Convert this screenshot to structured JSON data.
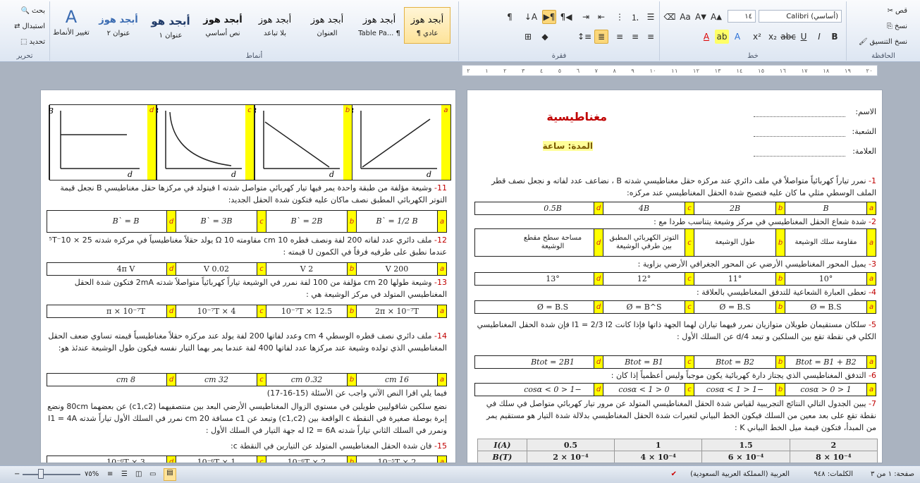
{
  "ribbon": {
    "clipboard": {
      "label": "الحافظة",
      "cut": "قص",
      "copy": "نسخ",
      "format_painter": "نسخ التنسيق"
    },
    "font": {
      "label": "خط",
      "font_name": "(أساسي) Calibri",
      "font_size": "١٤"
    },
    "paragraph": {
      "label": "فقرة"
    },
    "styles": {
      "label": "أنماط",
      "items": [
        {
          "preview": "أبجد هوز",
          "name": "¶ عادي"
        },
        {
          "preview": "أبجد هوز",
          "name": "Table Pa... ¶"
        },
        {
          "preview": "أبجد هوز",
          "name": "العنوان"
        },
        {
          "preview": "أبجد هوز",
          "name": "بلا تباعد"
        },
        {
          "preview": "أبجد هوز",
          "name": "نص أساسي"
        },
        {
          "preview": "أبجد هو",
          "name": "عنوان ١"
        },
        {
          "preview": "أبجد هوز",
          "name": "عنوان ٢"
        }
      ],
      "change_styles": "تغيير الأنماط"
    },
    "editing": {
      "label": "تحرير",
      "find": "بحث",
      "replace": "استبدال",
      "select": "تحديد"
    }
  },
  "ruler": {
    "ticks": [
      "٢",
      "١",
      "٢",
      "٣",
      "٤",
      "٥",
      "٦",
      "٧",
      "٨",
      "٩",
      "١٠",
      "١١",
      "١٢",
      "١٣",
      "١٤",
      "١٥",
      "١٦",
      "١٧",
      "١٨",
      "١٩",
      "٢٠"
    ]
  },
  "right_page": {
    "title": "مغناطيسية",
    "duration": "المدة: ساعة",
    "name_label": "الاسم:",
    "section_label": "الشعبة:",
    "grade_label": "العلامة:",
    "q1": {
      "num": "1-",
      "text": "نمرر تياراً كهربائياً متواصلاً في ملف دائري عند مركزه حقل مغناطيسي شدته B ، نضاعف عدد لفاته و نجعل نصف قطر الملف الوسطي مثلي ما كان عليه فتصبح شدة الحقل المغناطيسي عند مركزه:",
      "opts": [
        "B",
        "2B",
        "4B",
        "0.5B"
      ]
    },
    "q2": {
      "num": "2-",
      "text": "شدة شعاع الحقل المغناطيسي في مركز وشيعة يتناسب طردا مع :",
      "opts": [
        "مقاومة سلك الوشيعة",
        "طول الوشيعة",
        "التوتر الكهربائي المطبق بين طرفي الوشيعة",
        "مساحة سطح مقطع الوشيعة"
      ]
    },
    "q3": {
      "num": "3-",
      "text": "يميل المحور المغناطيسي الأرضي عن المحور الجغرافي الأرضي بزاوية :",
      "opts": [
        "10°",
        "11°",
        "12°",
        "13°"
      ]
    },
    "q4": {
      "num": "4-",
      "text": "تعطى العبارة الشعاعية للتدفق المغناطيسي بالعلاقة :",
      "opts": [
        "Ø = B.S",
        "Ø = B.S",
        "Ø = B^S",
        "Ø = B.S"
      ]
    },
    "q5": {
      "num": "5-",
      "text": "سلكان مستقيمان طويلان متوازيان نمرر فيهما تياران لهما الجهة ذاتها فإذا كانت I1 = 2/3 I2 فإن شدة الحقل المغناطيسي الكلي في نقطة تقع بين السلكين و تبعد d/4 عن السلك الأول :",
      "opts": [
        "Btot = B1 + B2",
        "Btot = B2",
        "Btot = B1",
        "Btot = 2B1"
      ]
    },
    "q6": {
      "num": "6-",
      "text": "التدفق المغناطيسي الذي يجتاز دارة كهربائية يكون موجباً وليس أعظمياً إذا كان :",
      "opts": [
        "1 < cosα > 0",
        "−1 < cosα < 1",
        "0 < cosα < 1",
        "−1 < cosα < 0"
      ]
    },
    "q7": {
      "num": "7-",
      "text": "يبين الجدول التالي النتائج التجريبية لقياس شدة الحقل المغناطيسي المتولد عن مرور تيار كهربائي متواصل في سلك في نقطة تقع على بعد معين من السلك فيكون الخط البياني لتغيرات شدة الحقل المغناطيسي بدلالة شدة التيار هو مستقيم يمر من المبدأ، فتكون قيمة ميل الخط البياني K :"
    },
    "table": {
      "headers": [
        "I(A)",
        "0.5",
        "1",
        "1.5",
        "2"
      ],
      "row2": [
        "B(T)",
        "2 × 10⁻⁴",
        "4 × 10⁻⁴",
        "6 × 10⁻⁴",
        "8 × 10⁻⁴"
      ]
    }
  },
  "left_page": {
    "letters": [
      "a",
      "b",
      "c",
      "d"
    ],
    "graph_axis": {
      "y": "B",
      "x": "d"
    },
    "q11": {
      "num": "11-",
      "text": "وشيعة مؤلفة من طبقة واحدة يمر فيها تيار كهربائي متواصل شدته I فيتولد في مركزها حقل مغناطيسي B نجعل قيمة التوتر الكهربائي المطبق نصف ماكان عليه فتكون شدة الحقل الجديد:",
      "opts": [
        "B` = 1/2 B",
        "B` = 2B",
        "B` = 3B",
        "B` = B"
      ]
    },
    "q12": {
      "num": "12-",
      "text": "ملف دائري عدد لفاته 200 لفة ونصف قطره 10 cm مقاومته 10 Ω يولد حقلاً مغناطيسياً في مركزه شدته 25 × 10⁻⁵T عندما نطبق على طرفيه فرقاً في الكمون U قيمته :",
      "opts": [
        "200 V",
        "2 V",
        "0.02 V",
        "4π V"
      ]
    },
    "q13": {
      "num": "13-",
      "text": "وشيعة طولها 20 cm مؤلفة من 100 لفة نمرر في الوشيعة تياراً كهربائياً متواصلاً شدته 2mA فتكون شدة الحقل المغناطيسي المتولد في مركز الوشيعة هي :",
      "opts": [
        "2π × 10⁻⁷T",
        "12.5 × 10⁻⁷T",
        "4 × 10⁻⁷T",
        "π × 10⁻⁷T"
      ]
    },
    "q14": {
      "num": "14-",
      "text": "ملف دائري نصف قطره الوسطي 4 cm وعدد لفاتها 200 لفة يولد عند مركزه حقلاً مغناطيسياً قيمته تساوي ضعف الحقل المغناطيسي الذي تولده وشيعة عند مركزها عدد لفاتها 400 لفة عندما يمر بهما التيار نفسه فيكون طول الوشيعة عندئذ هو:",
      "opts": [
        "16 cm",
        "0.32 cm",
        "32 cm",
        "8 cm"
      ]
    },
    "read_text": "فيما يلي اقرا النص الآتي واجب عن الأسئلة (15-16-17)",
    "para": "نضع سلكين شاقوليين طويلين في مستوي الزوال المغناطيسي الأرضي البعد بين منتصفيهما (c1,c2) عن بعضهما 80cm ونضع إبرة بوصلة صغيرة في النقطة c الواقعة بين (c1,c2) وتبعد عن c1 مسافة 20 cm نمرر في السلك الأول تياراً شدته I1 = 4A ونمرر في السلك الثاني تياراً شدته I2 = 6A له جهة التيار في السلك الأول :",
    "q15": {
      "num": "15-",
      "text": "فان شدة الحقل المغناطيسي المتولد عن التيارين في النقطة c:",
      "opts": [
        "2 × 10⁻⁵T",
        "2 × 10⁻⁶T",
        "1 × 10⁻⁶T",
        "3 × 10⁻⁶T"
      ]
    }
  },
  "status": {
    "page": "صفحة: ١ من ٣",
    "words": "الكلمات: ٩٤٨",
    "lang": "العربية (المملكة العربية السعودية)",
    "zoom": "٧٥%"
  }
}
